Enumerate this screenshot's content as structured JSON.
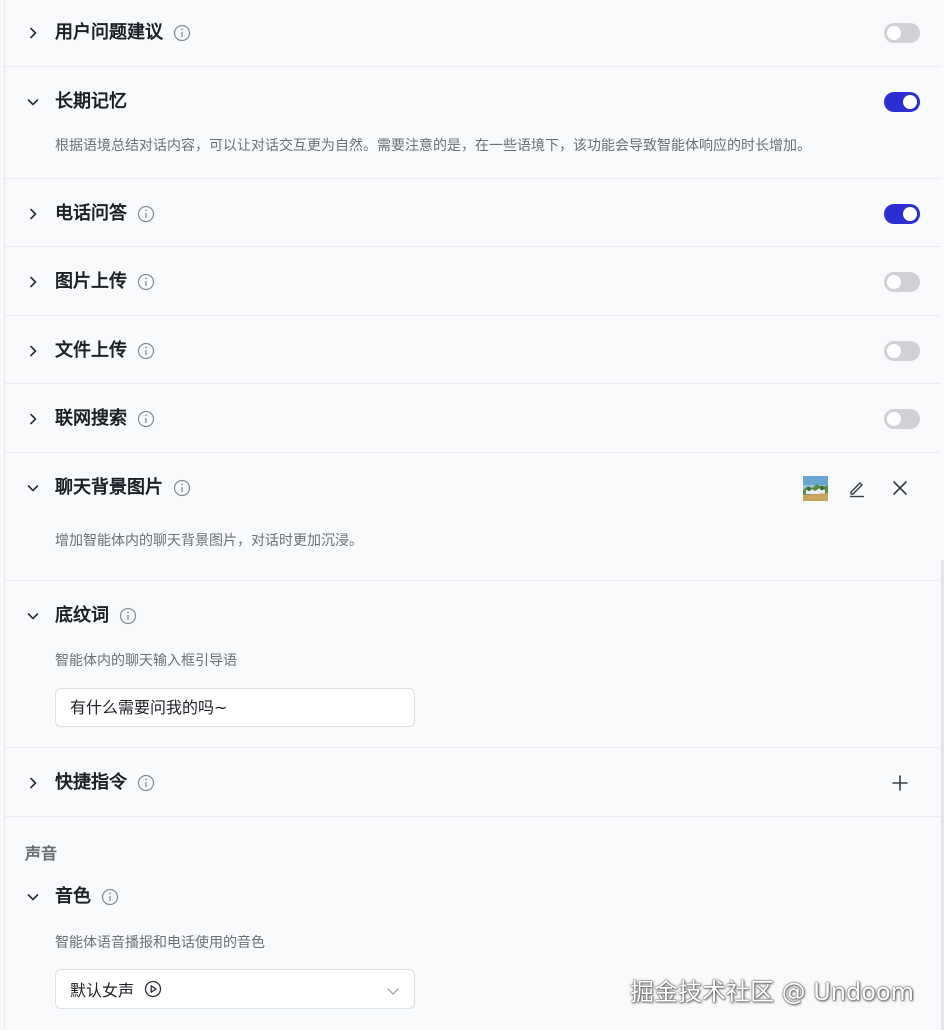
{
  "settings": {
    "suggest": {
      "title": "用户问题建议",
      "enabled": false
    },
    "memory": {
      "title": "长期记忆",
      "enabled": true,
      "desc": "根据语境总结对话内容，可以让对话交互更为自然。需要注意的是，在一些语境下，该功能会导致智能体响应的时长增加。"
    },
    "phone": {
      "title": "电话问答",
      "enabled": true
    },
    "image_upload": {
      "title": "图片上传",
      "enabled": false
    },
    "file_upload": {
      "title": "文件上传",
      "enabled": false
    },
    "web_search": {
      "title": "联网搜索",
      "enabled": false
    },
    "background": {
      "title": "聊天背景图片",
      "desc": "增加智能体内的聊天背景图片，对话时更加沉浸。"
    },
    "placeholder": {
      "title": "底纹词",
      "desc": "智能体内的聊天输入框引导语",
      "value": "有什么需要问我的吗~"
    },
    "shortcut": {
      "title": "快捷指令"
    }
  },
  "voice": {
    "section_label": "声音",
    "timbre": {
      "title": "音色",
      "desc": "智能体语音播报和电话使用的音色",
      "selected": "默认女声"
    }
  },
  "watermark": "掘金技术社区 @ Undoom",
  "colors": {
    "accent": "#2c2ed1",
    "toggle_off": "#cfd1d6"
  }
}
